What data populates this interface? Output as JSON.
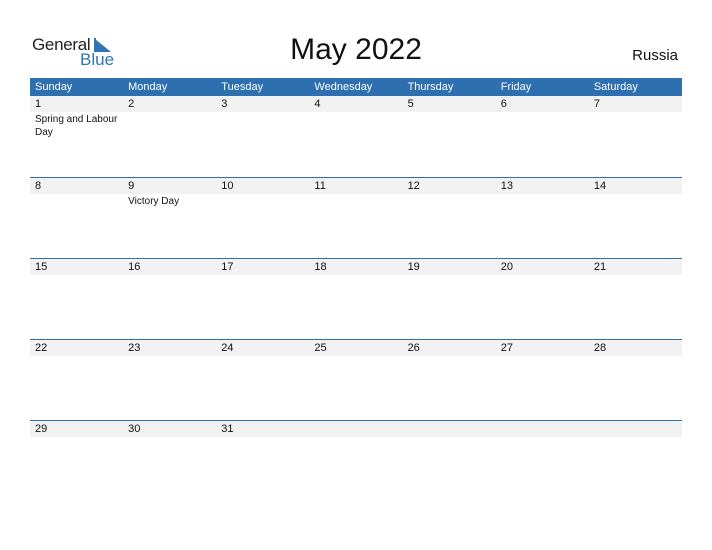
{
  "logo": {
    "general": "General",
    "blue": "Blue"
  },
  "title": "May 2022",
  "country": "Russia",
  "colors": {
    "header": "#2e6fb0",
    "date_row": "#f2f2f2",
    "logo_blue": "#2e75b6"
  },
  "weekdays": [
    "Sunday",
    "Monday",
    "Tuesday",
    "Wednesday",
    "Thursday",
    "Friday",
    "Saturday"
  ],
  "weeks": [
    {
      "dates": [
        "1",
        "2",
        "3",
        "4",
        "5",
        "6",
        "7"
      ],
      "events": [
        "Spring and Labour Day",
        "",
        "",
        "",
        "",
        "",
        ""
      ]
    },
    {
      "dates": [
        "8",
        "9",
        "10",
        "11",
        "12",
        "13",
        "14"
      ],
      "events": [
        "",
        "Victory Day",
        "",
        "",
        "",
        "",
        ""
      ]
    },
    {
      "dates": [
        "15",
        "16",
        "17",
        "18",
        "19",
        "20",
        "21"
      ],
      "events": [
        "",
        "",
        "",
        "",
        "",
        "",
        ""
      ]
    },
    {
      "dates": [
        "22",
        "23",
        "24",
        "25",
        "26",
        "27",
        "28"
      ],
      "events": [
        "",
        "",
        "",
        "",
        "",
        "",
        ""
      ]
    },
    {
      "dates": [
        "29",
        "30",
        "31",
        "",
        "",
        "",
        ""
      ],
      "events": [
        "",
        "",
        "",
        "",
        "",
        "",
        ""
      ]
    }
  ]
}
